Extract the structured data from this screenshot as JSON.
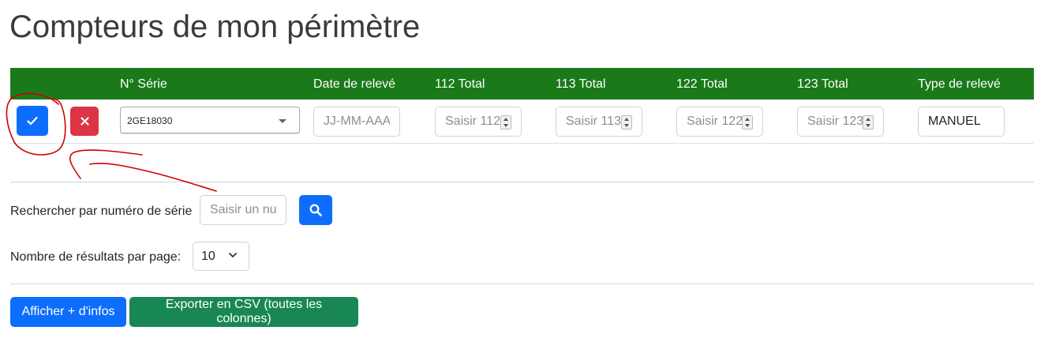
{
  "page": {
    "title": "Compteurs de mon périmètre"
  },
  "table": {
    "headers": [
      "",
      "N° Série",
      "Date de relevé",
      "112 Total",
      "113 Total",
      "122 Total",
      "123 Total",
      "Type de relevé"
    ],
    "row": {
      "serial": "2GE18030",
      "date_placeholder": "JJ-MM-AAA",
      "totals_placeholders": [
        "Saisir 112",
        "Saisir 113",
        "Saisir 122",
        "Saisir 123"
      ],
      "type_value": "MANUEL"
    }
  },
  "search": {
    "label": "Rechercher par numéro de série",
    "placeholder": "Saisir un numéro"
  },
  "pagination": {
    "label": "Nombre de résultats par page:",
    "value": "10"
  },
  "actions": {
    "more_info": "Afficher + d'infos",
    "export_csv": "Exporter en CSV (toutes les colonnes)"
  },
  "colors": {
    "header_bg": "#1a7a1a",
    "primary": "#0d6efd",
    "danger": "#dc3545",
    "success": "#198754",
    "annotation": "#d00000"
  },
  "icons": [
    "check-icon",
    "close-icon",
    "caret-down-icon",
    "spinner-icon",
    "search-icon",
    "chevron-down-icon"
  ]
}
